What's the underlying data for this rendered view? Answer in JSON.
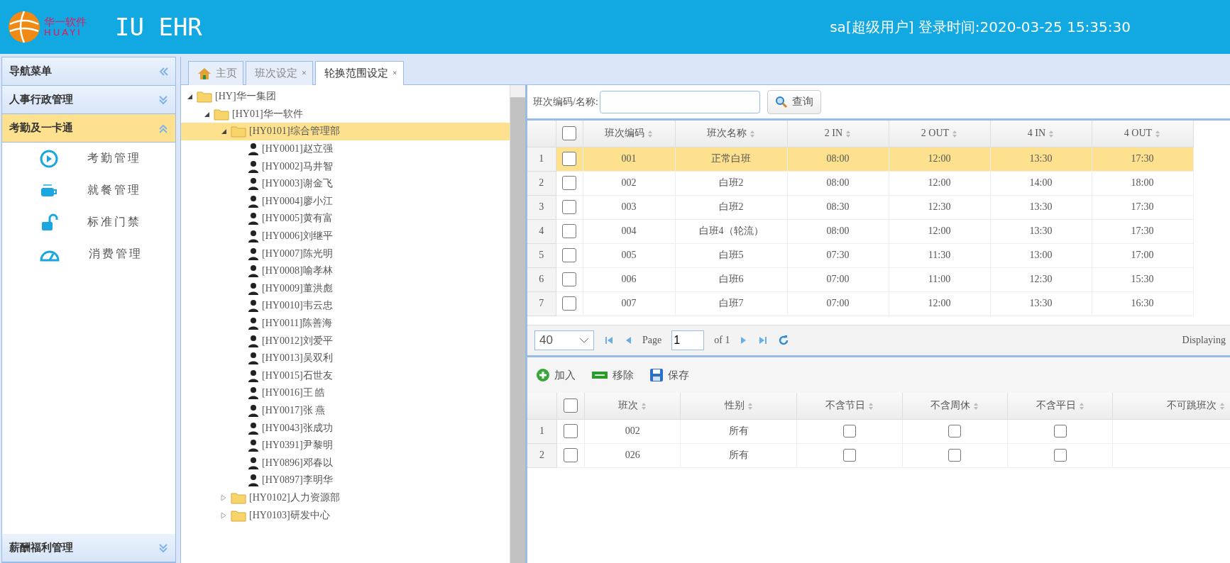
{
  "header": {
    "logo_cn": "华一软件",
    "logo_en": "HUAYI",
    "title": "IU EHR",
    "user": "sa[超级用户] 登录时间:2020-03-25 15:35:30"
  },
  "sidebar": {
    "title": "导航菜单",
    "groups": [
      {
        "label": "人事行政管理",
        "expanded": false,
        "selected": false
      },
      {
        "label": "考勤及一卡通",
        "expanded": true,
        "selected": true,
        "items": [
          {
            "label": "考勤管理",
            "kind": "clock"
          },
          {
            "label": "就餐管理",
            "kind": "cup"
          },
          {
            "label": "标准门禁",
            "kind": "lock"
          },
          {
            "label": "消费管理",
            "kind": "gauge"
          }
        ]
      }
    ],
    "bottom_group": {
      "label": "薪酬福利管理",
      "expanded": false
    }
  },
  "tabs": [
    {
      "label": "主页",
      "kind": "home",
      "selected": false
    },
    {
      "label": "班次设定",
      "kind": "plain",
      "close": "×",
      "selected": false
    },
    {
      "label": "轮换范围设定",
      "kind": "plain",
      "close": "×",
      "selected": true
    }
  ],
  "tree": [
    {
      "label": "[HY]华一集团",
      "kind": "folder",
      "expanded": true,
      "selected": false,
      "children": [
        {
          "label": "[HY01]华一软件",
          "kind": "folder",
          "expanded": true,
          "selected": false,
          "children": [
            {
              "label": "[HY0101]综合管理部",
              "kind": "folder",
              "expanded": true,
              "selected": true,
              "children": [
                {
                  "label": "[HY0001]赵立强",
                  "kind": "person",
                  "selected": false
                },
                {
                  "label": "[HY0002]马井智",
                  "kind": "person",
                  "selected": false
                },
                {
                  "label": "[HY0003]谢金飞",
                  "kind": "person",
                  "selected": false
                },
                {
                  "label": "[HY0004]廖小江",
                  "kind": "person",
                  "selected": false
                },
                {
                  "label": "[HY0005]黄有富",
                  "kind": "person",
                  "selected": false
                },
                {
                  "label": "[HY0006]刘继平",
                  "kind": "person",
                  "selected": false
                },
                {
                  "label": "[HY0007]陈光明",
                  "kind": "person",
                  "selected": false
                },
                {
                  "label": "[HY0008]喻孝林",
                  "kind": "person",
                  "selected": false
                },
                {
                  "label": "[HY0009]董洪彪",
                  "kind": "person",
                  "selected": false
                },
                {
                  "label": "[HY0010]韦云忠",
                  "kind": "person",
                  "selected": false
                },
                {
                  "label": "[HY0011]陈善海",
                  "kind": "person",
                  "selected": false
                },
                {
                  "label": "[HY0012]刘爱平",
                  "kind": "person",
                  "selected": false
                },
                {
                  "label": "[HY0013]吴双利",
                  "kind": "person",
                  "selected": false
                },
                {
                  "label": "[HY0015]石世友",
                  "kind": "person",
                  "selected": false
                },
                {
                  "label": "[HY0016]王 皓",
                  "kind": "person",
                  "selected": false
                },
                {
                  "label": "[HY0017]张 燕",
                  "kind": "person",
                  "selected": false
                },
                {
                  "label": "[HY0043]张成功",
                  "kind": "person",
                  "selected": false
                },
                {
                  "label": "[HY0391]尹黎明",
                  "kind": "person",
                  "selected": false
                },
                {
                  "label": "[HY0896]邓春以",
                  "kind": "person",
                  "selected": false
                },
                {
                  "label": "[HY0897]李明华",
                  "kind": "person",
                  "selected": false
                }
              ]
            },
            {
              "label": "[HY0102]人力资源部",
              "kind": "folder",
              "expanded": false,
              "selected": false
            },
            {
              "label": "[HY0103]研发中心",
              "kind": "folder",
              "expanded": false,
              "selected": false
            }
          ]
        }
      ]
    }
  ],
  "search": {
    "label": "班次编码/名称:",
    "button": "查询"
  },
  "shift_table": {
    "select_all_checked": false,
    "columns": [
      "班次编码",
      "班次名称",
      "2 IN",
      "2 OUT",
      "4 IN",
      "4 OUT"
    ],
    "rows": [
      {
        "num": "1",
        "checked": false,
        "selected": true,
        "cells": [
          "001",
          "正常白班",
          "08:00",
          "12:00",
          "13:30",
          "17:30"
        ]
      },
      {
        "num": "2",
        "checked": false,
        "selected": false,
        "cells": [
          "002",
          "白班2",
          "08:00",
          "12:00",
          "14:00",
          "18:00"
        ]
      },
      {
        "num": "3",
        "checked": false,
        "selected": false,
        "cells": [
          "003",
          "白班2",
          "08:30",
          "12:30",
          "13:30",
          "17:30"
        ]
      },
      {
        "num": "4",
        "checked": false,
        "selected": false,
        "cells": [
          "004",
          "白班4（轮流）",
          "08:00",
          "12:00",
          "13:30",
          "17:30"
        ]
      },
      {
        "num": "5",
        "checked": false,
        "selected": false,
        "cells": [
          "005",
          "白班5",
          "07:30",
          "11:30",
          "13:00",
          "17:00"
        ]
      },
      {
        "num": "6",
        "checked": false,
        "selected": false,
        "cells": [
          "006",
          "白班6",
          "07:00",
          "11:00",
          "12:30",
          "15:30"
        ]
      },
      {
        "num": "7",
        "checked": false,
        "selected": false,
        "cells": [
          "007",
          "白班7",
          "07:00",
          "12:00",
          "13:30",
          "16:30"
        ]
      }
    ]
  },
  "pager": {
    "page_size": "40",
    "page_label": "Page",
    "page": "1",
    "of": "of 1",
    "display": "Displaying"
  },
  "toolbar": [
    {
      "label": "加入",
      "kind": "add"
    },
    {
      "label": "移除",
      "kind": "remove"
    },
    {
      "label": "保存",
      "kind": "save"
    }
  ],
  "range_table": {
    "select_all_checked": false,
    "columns": [
      "班次",
      "性别",
      "不含节日",
      "不含周休",
      "不含平日",
      "不可跳班次"
    ],
    "rows": [
      {
        "num": "1",
        "checked": false,
        "cells": [
          "002",
          "所有"
        ],
        "flags": [
          false,
          false,
          false
        ]
      },
      {
        "num": "2",
        "checked": false,
        "cells": [
          "026",
          "所有"
        ],
        "flags": [
          false,
          false,
          false
        ]
      }
    ]
  }
}
